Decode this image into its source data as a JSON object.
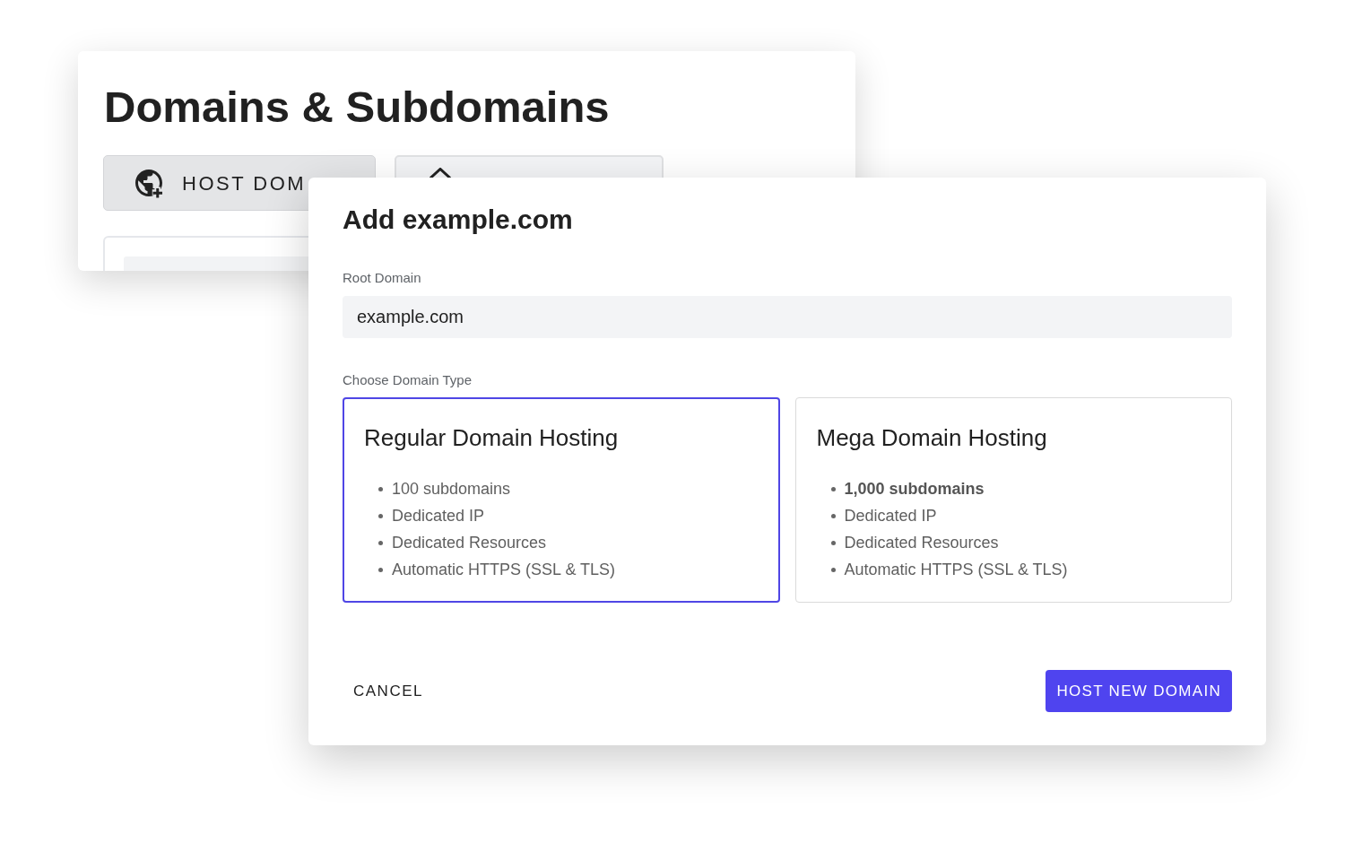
{
  "background_window": {
    "title": "Domains & Subdomains",
    "host_button": {
      "label": "HOST DOM"
    }
  },
  "dialog": {
    "title": "Add example.com",
    "root_domain": {
      "label": "Root Domain",
      "value": "example.com"
    },
    "domain_type": {
      "label": "Choose Domain Type",
      "options": [
        {
          "title": "Regular Domain Hosting",
          "selected": true,
          "features": [
            {
              "text": "100 subdomains",
              "bold": false
            },
            {
              "text": "Dedicated IP",
              "bold": false
            },
            {
              "text": "Dedicated Resources",
              "bold": false
            },
            {
              "text": "Automatic HTTPS (SSL & TLS)",
              "bold": false
            }
          ]
        },
        {
          "title": "Mega Domain Hosting",
          "selected": false,
          "features": [
            {
              "text": "1,000 subdomains",
              "bold": true
            },
            {
              "text": "Dedicated IP",
              "bold": false
            },
            {
              "text": "Dedicated Resources",
              "bold": false
            },
            {
              "text": "Automatic HTTPS (SSL & TLS)",
              "bold": false
            }
          ]
        }
      ]
    },
    "actions": {
      "cancel": "CANCEL",
      "confirm": "HOST NEW DOMAIN"
    }
  }
}
